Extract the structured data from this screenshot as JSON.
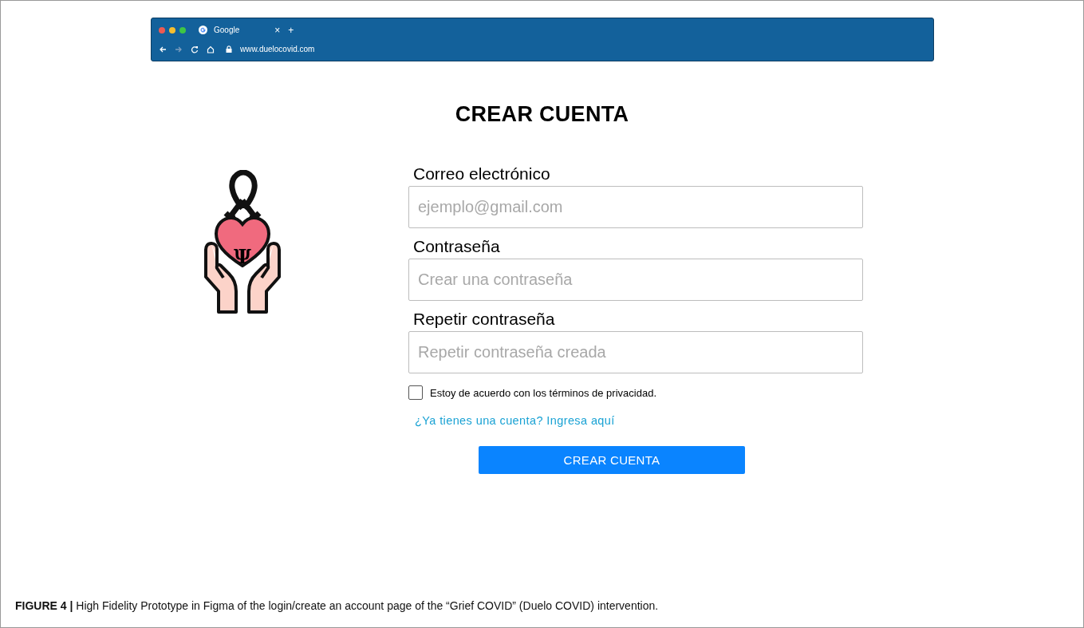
{
  "browser": {
    "tab_title": "Google",
    "tab_close": "×",
    "new_tab": "+",
    "url": "www.duelocovid.com"
  },
  "page": {
    "title": "CREAR CUENTA",
    "logo_symbol": "Ψ",
    "fields": [
      {
        "label": "Correo electrónico",
        "placeholder": "ejemplo@gmail.com"
      },
      {
        "label": "Contraseña",
        "placeholder": "Crear una contraseña"
      },
      {
        "label": "Repetir contraseña",
        "placeholder": "Repetir contraseña creada"
      }
    ],
    "terms": {
      "label": "Estoy de acuerdo con los términos de privacidad.",
      "checked": false
    },
    "login_link": "¿Ya tienes una cuenta? Ingresa aquí",
    "submit": "CREAR CUENTA"
  },
  "caption": "**FIGURE 4 |** High Fidelity Prototype in Figma of the login/create an account page of the “Grief COVID” (Duelo COVID) intervention."
}
